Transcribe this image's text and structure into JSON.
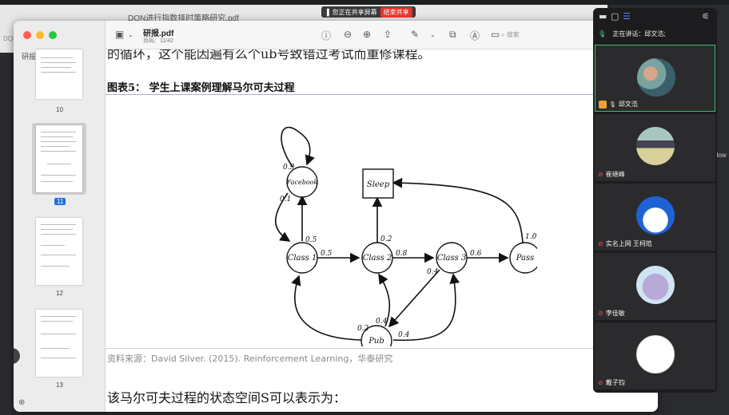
{
  "background": {
    "window_title": "DQN进行指数择时策略研究.pdf",
    "side_label": "DQN",
    "right_edge_label": "dow"
  },
  "share_banner": {
    "status": "您正在共享屏幕",
    "stop_label": "结束共享"
  },
  "preview": {
    "sidebar_file": "研报.pdf",
    "thumbnails": [
      {
        "page": "10"
      },
      {
        "page": "11",
        "selected": true
      },
      {
        "page": "12"
      },
      {
        "page": "13"
      }
    ],
    "title": "研报.pdf",
    "subtitle": "页码：11/42",
    "search_placeholder": "搜索"
  },
  "document": {
    "top_line": "的循环，这个能因遍有么个ub号致错过考试而重修课程。",
    "figure_title": "图表5：  学生上课案例理解马尔可夫过程",
    "source": "资料来源：David Silver. (2015). Reinforcement Learning，华泰研究",
    "bottom_line": "该马尔可夫过程的状态空间S可以表示为：",
    "diagram": {
      "nodes": {
        "facebook": "Facebook",
        "sleep": "Sleep",
        "class1": "Class 1",
        "class2": "Class 2",
        "class3": "Class 3",
        "pass": "Pass",
        "pub": "Pub"
      },
      "edge_labels": {
        "fb_self": "0.9",
        "fb_to_c1": "0.1",
        "c1_to_fb": "0.5",
        "c1_to_c2": "0.5",
        "c2_to_sleep": "0.2",
        "c2_to_c3": "0.8",
        "c3_to_pass": "0.6",
        "pass_to_sleep": "1.0",
        "c3_to_pub": "0.4",
        "pub_to_c1": "0.2",
        "pub_to_c2": "0.4",
        "pub_to_c3": "0.4"
      }
    }
  },
  "meeting_panel": {
    "speaking_label": "正在讲话：邱文浩;",
    "participants": [
      {
        "name": "邱文浩",
        "active": true
      },
      {
        "name": "崔继峰"
      },
      {
        "name": "实名上网 王柯皓"
      },
      {
        "name": "李佳敏"
      },
      {
        "name": "戴子钧"
      }
    ]
  }
}
